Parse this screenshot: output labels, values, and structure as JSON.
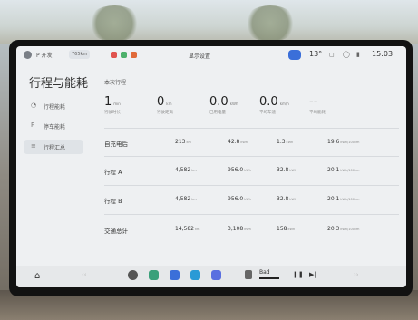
{
  "status": {
    "user_name": "P 开发",
    "chip_text": "765km",
    "title": "显示设置",
    "temperature": "13°",
    "time": "15:03"
  },
  "sidebar": {
    "title": "行程与能耗",
    "items": [
      {
        "label": "行程能耗",
        "icon": "chart-icon"
      },
      {
        "label": "停车能耗",
        "icon": "parking-icon"
      },
      {
        "label": "行程汇总",
        "icon": "summary-icon",
        "active": true
      }
    ]
  },
  "current_trip": {
    "section_label": "本次行程",
    "stats": [
      {
        "value": "1",
        "unit": "min",
        "label": "行驶时长"
      },
      {
        "value": "0",
        "unit": "km",
        "label": "行驶距离"
      },
      {
        "value": "0.0",
        "unit": "kWh",
        "label": "已用电量"
      },
      {
        "value": "0.0",
        "unit": "km/h",
        "label": "平均车速"
      },
      {
        "value": "--",
        "unit": "",
        "label": "平均能耗"
      }
    ]
  },
  "table": {
    "rows": [
      {
        "label": "自充电后",
        "cells": [
          {
            "v": "213",
            "u": "km"
          },
          {
            "v": "42.8",
            "u": "kWh"
          },
          {
            "v": "1.3",
            "u": "kWh"
          },
          {
            "v": "19.6",
            "u": "kWh/100km"
          }
        ]
      },
      {
        "label": "行程 A",
        "cells": [
          {
            "v": "4,582",
            "u": "km"
          },
          {
            "v": "956.0",
            "u": "kWh"
          },
          {
            "v": "32.8",
            "u": "kWh"
          },
          {
            "v": "20.1",
            "u": "kWh/100km"
          }
        ]
      },
      {
        "label": "行程 B",
        "cells": [
          {
            "v": "4,582",
            "u": "km"
          },
          {
            "v": "956.0",
            "u": "kWh"
          },
          {
            "v": "32.8",
            "u": "kWh"
          },
          {
            "v": "20.1",
            "u": "kWh/100km"
          }
        ]
      },
      {
        "label": "交通总计",
        "cells": [
          {
            "v": "14,582",
            "u": "km"
          },
          {
            "v": "3,108",
            "u": "kWh"
          },
          {
            "v": "158",
            "u": "kWh"
          },
          {
            "v": "20.3",
            "u": "kWh/100km"
          }
        ]
      }
    ]
  },
  "taskbar": {
    "media_label": "Bad",
    "play_pause": "❚❚",
    "next": "▶|",
    "home": "⌂"
  }
}
